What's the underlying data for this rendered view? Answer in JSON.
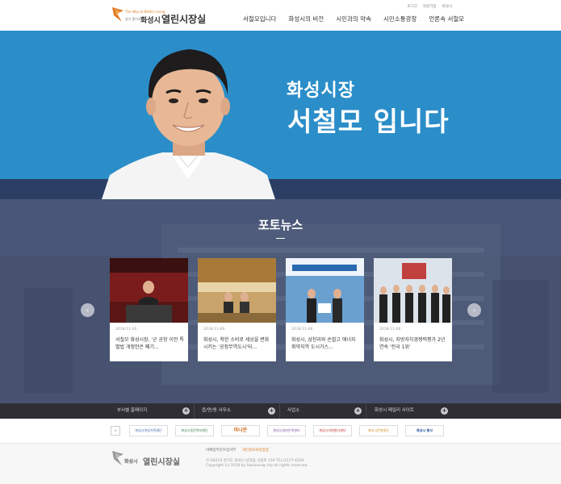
{
  "header": {
    "logo": {
      "tagline": "The Way to Better Living",
      "slogan": "살기 좋아요",
      "city": "화성시",
      "name": "열린시장실"
    },
    "util_links": [
      "로그인",
      "회원가입",
      "화성시"
    ],
    "nav": [
      "서철모입니다",
      "화성시의 비전",
      "시민과의 약속",
      "시민소통광장",
      "언론속 서철모"
    ]
  },
  "hero": {
    "line1": "화성시장",
    "line2": "서철모 입니다"
  },
  "photo_news": {
    "title": "포토뉴스",
    "prev_label": "‹",
    "next_label": "›",
    "items": [
      {
        "date": "2018-11-16",
        "title": "서철모 화성시장, '군 공항 이전 특별법 개정안은 폐기..."
      },
      {
        "date": "2018-11-09",
        "title": "화성시, 착한 소비로 세상을 변화시키는 '공정무역도시'되..."
      },
      {
        "date": "2018-11-08",
        "title": "화성시, 삼천리와 손잡고 에너지 취약지역 도시가스..."
      },
      {
        "date": "2018-11-08",
        "title": "화성시, 지방자치경쟁력평가 2년 연속 '전국 1위'"
      }
    ]
  },
  "family_bar": {
    "items": [
      "부서별 홈페이지",
      "읍/면/동 사무소",
      "사업소",
      "화성시 패밀리 사이트"
    ],
    "plus": "+"
  },
  "banners": [
    "화성시여성가족재단",
    "화성시동탄복지재단",
    "마나온",
    "화성시실버인력센터",
    "화성시자원봉사센터",
    "화성시문화재단",
    "화성시 봉사",
    "화성시 청년센터"
  ],
  "footer": {
    "city": "화성시",
    "name": "열린시장실",
    "link1": "이메일무단수집거부",
    "link2": "개인정보처리방침",
    "address": "우)18274 경기도 화성시 남양읍 시청로 159 TEL)1577-4200",
    "copyright": "Copyright (c) 2018 by hwaseong city all rights reserved."
  },
  "colors": {
    "hero_blue": "#2b8ec9",
    "navy_band": "#2c3e63",
    "news_bg": "#4b5878",
    "dark_bar": "#2e2e34",
    "accent_orange": "#e07a22"
  }
}
